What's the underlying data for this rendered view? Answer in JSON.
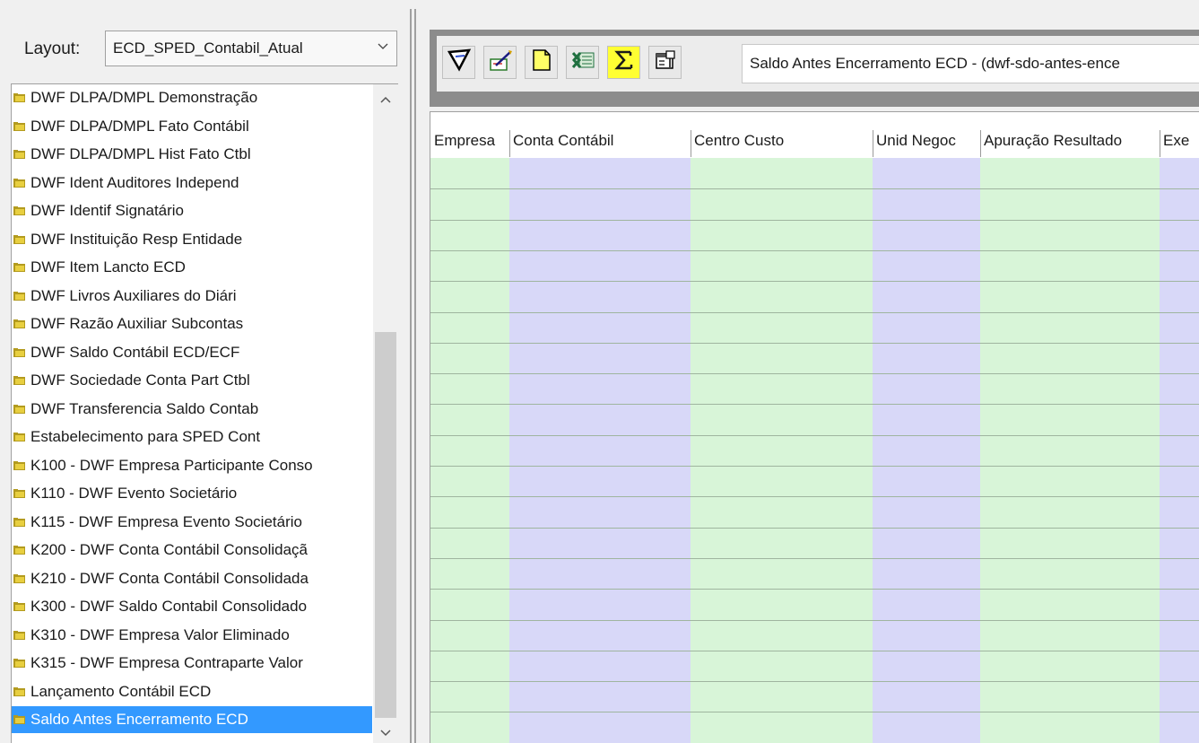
{
  "layout": {
    "label": "Layout:",
    "selected": "ECD_SPED_Contabil_Atual"
  },
  "tree": {
    "items": [
      {
        "label": "DWF DLPA/DMPL Demonstração"
      },
      {
        "label": "DWF DLPA/DMPL Fato Contábil"
      },
      {
        "label": "DWF DLPA/DMPL Hist Fato Ctbl"
      },
      {
        "label": "DWF Ident Auditores Independ"
      },
      {
        "label": "DWF Identif Signatário"
      },
      {
        "label": "DWF Instituição Resp Entidade"
      },
      {
        "label": "DWF Item Lancto ECD"
      },
      {
        "label": "DWF Livros Auxiliares do Diári"
      },
      {
        "label": "DWF Razão Auxiliar Subcontas"
      },
      {
        "label": "DWF Saldo Contábil ECD/ECF"
      },
      {
        "label": "DWF Sociedade Conta Part Ctbl"
      },
      {
        "label": "DWF Transferencia Saldo Contab"
      },
      {
        "label": "Estabelecimento para SPED Cont"
      },
      {
        "label": "K100 - DWF Empresa Participante Conso"
      },
      {
        "label": "K110 - DWF Evento Societário"
      },
      {
        "label": "K115 - DWF Empresa Evento Societário"
      },
      {
        "label": "K200 - DWF Conta Contábil Consolidaçã"
      },
      {
        "label": "K210 - DWF Conta Contábil Consolidada"
      },
      {
        "label": "K300 - DWF Saldo Contabil Consolidado"
      },
      {
        "label": "K310 - DWF Empresa Valor Eliminado"
      },
      {
        "label": "K315 - DWF Empresa Contraparte Valor"
      },
      {
        "label": "Lançamento Contábil ECD"
      },
      {
        "label": "Saldo Antes Encerramento ECD"
      }
    ],
    "selected_index": 22
  },
  "toolbar": {
    "buttons": [
      {
        "icon": "filter-icon"
      },
      {
        "icon": "edit-icon"
      },
      {
        "icon": "new-document-icon"
      },
      {
        "icon": "excel-icon"
      },
      {
        "icon": "sum-icon"
      },
      {
        "icon": "properties-icon"
      }
    ],
    "title": "Saldo Antes Encerramento ECD - (dwf-sdo-antes-ence"
  },
  "grid": {
    "columns": [
      {
        "label": "Empresa",
        "color": "#d8f5d8"
      },
      {
        "label": "Conta Contábil",
        "color": "#d8d8f8"
      },
      {
        "label": "Centro Custo",
        "color": "#d8f5d8"
      },
      {
        "label": "Unid Negoc",
        "color": "#d8d8f8"
      },
      {
        "label": "Apuração Resultado",
        "color": "#d8f5d8"
      },
      {
        "label": "Exe",
        "color": "#d8d8f8"
      }
    ]
  },
  "colors": {
    "selection": "#3399ff",
    "folder": "#b39b1f",
    "toolbar_frame": "#8c8c8c"
  }
}
